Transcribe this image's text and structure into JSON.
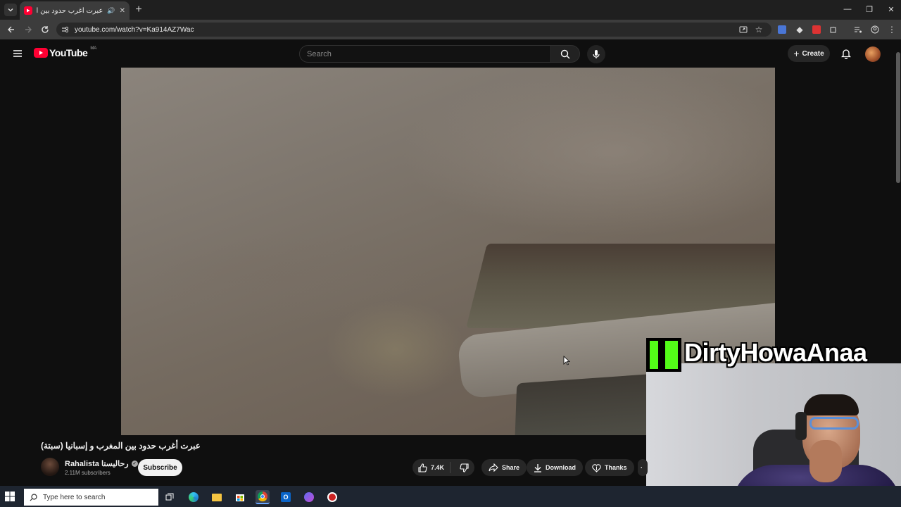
{
  "browser": {
    "tab_title": "عبرت أغرب حدود بين المغرب",
    "url": "youtube.com/watch?v=Ka914AZ7Wac"
  },
  "youtube": {
    "logo_text": "YouTube",
    "region": "MA",
    "search_placeholder": "Search",
    "create_label": "Create"
  },
  "video": {
    "title": "عبرت أغرب حدود بين المغرب و إسبانيا (سبتة)",
    "channel_name": "Rahalista رحاليستا",
    "subscribers": "2.11M subscribers",
    "subscribe_label": "Subscribe",
    "likes": "7.4K",
    "share_label": "Share",
    "download_label": "Download",
    "thanks_label": "Thanks"
  },
  "overlay": {
    "streamer_name": "DirtyHowaAnaa"
  },
  "taskbar": {
    "search_placeholder": "Type here to search"
  },
  "colors": {
    "youtube_red": "#ff0033",
    "kick_green": "#53fc18",
    "background": "#0f0f0f"
  }
}
